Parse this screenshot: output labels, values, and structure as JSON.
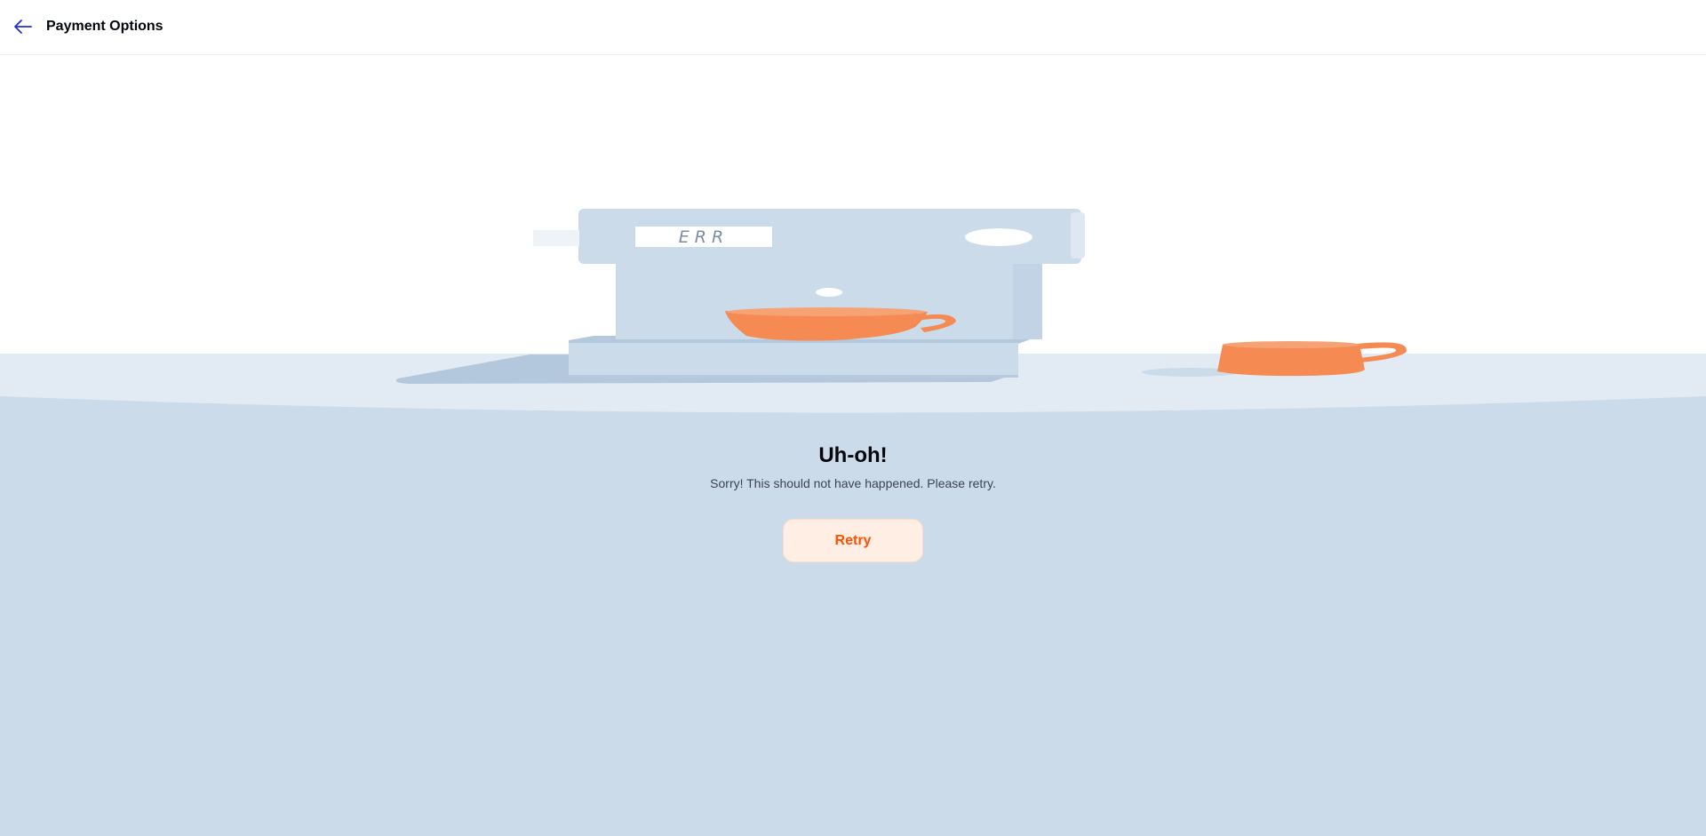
{
  "header": {
    "title": "Payment Options",
    "back_icon": "arrow-left-icon"
  },
  "illustration": {
    "display_text": "ERR",
    "icon": "coffee-machine-error-illustration"
  },
  "error": {
    "headline": "Uh-oh!",
    "message": "Sorry! This should not have happened. Please retry.",
    "retry_label": "Retry"
  },
  "colors": {
    "accent": "#ff5200",
    "retry_bg": "#ffeee4",
    "back_arrow": "#1f2fd6",
    "floor": "#cbdbea",
    "floor_light": "#e2ebf3",
    "machine": "#cbdbea",
    "cup": "#f58b53"
  }
}
